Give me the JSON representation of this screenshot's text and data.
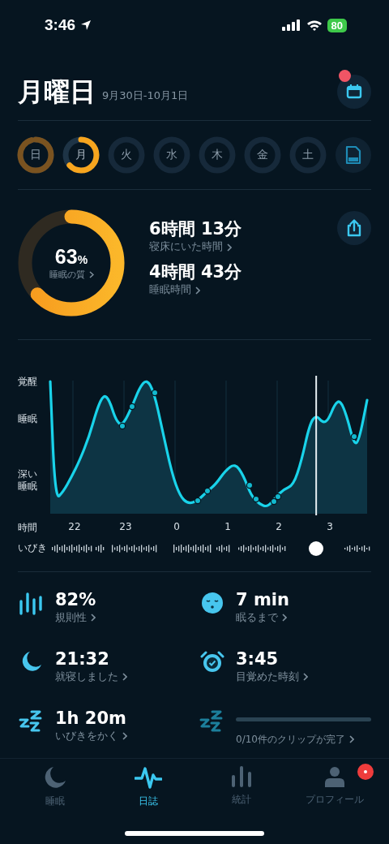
{
  "status_bar": {
    "time": "3:46",
    "battery": "80"
  },
  "header": {
    "title": "月曜日",
    "date_range": "9月30日-10月1日",
    "calendar_badge": true
  },
  "days": [
    {
      "label": "日",
      "has_data": true,
      "selected": false
    },
    {
      "label": "月",
      "has_data": true,
      "selected": true
    },
    {
      "label": "火",
      "has_data": false,
      "selected": false
    },
    {
      "label": "水",
      "has_data": false,
      "selected": false
    },
    {
      "label": "木",
      "has_data": false,
      "selected": false
    },
    {
      "label": "金",
      "has_data": false,
      "selected": false
    },
    {
      "label": "土",
      "has_data": false,
      "selected": false
    }
  ],
  "summary": {
    "quality": {
      "value": "63",
      "unit": "%",
      "label": "睡眠の質"
    },
    "metrics": [
      {
        "value": "6時間 13分",
        "label": "寝床にいた時間"
      },
      {
        "value": "4時間 43分",
        "label": "睡眠時間"
      }
    ]
  },
  "sleep_graph": {
    "y_labels": [
      "覚醒",
      "睡眠",
      "深い睡眠"
    ],
    "x_title": "時間",
    "x_labels": [
      "22",
      "23",
      "0",
      "1",
      "2",
      "3"
    ],
    "snore_title": "いびき"
  },
  "stats": [
    {
      "kind": "regularity",
      "value": "82%",
      "label": "規則性"
    },
    {
      "kind": "fall-asleep",
      "value": "7 min",
      "label": "眠るまで"
    },
    {
      "kind": "bedtime",
      "value": "21:32",
      "label": "就寝しました"
    },
    {
      "kind": "wake",
      "value": "3:45",
      "label": "目覚めた時刻"
    },
    {
      "kind": "snoring",
      "value": "1h 20m",
      "label": "いびきをかく"
    },
    {
      "kind": "clips",
      "label": "0/10件のクリップが完了"
    }
  ],
  "tabs": [
    {
      "kind": "sleep",
      "label": "睡眠",
      "selected": false,
      "badge": false
    },
    {
      "kind": "journal",
      "label": "日誌",
      "selected": true,
      "badge": false
    },
    {
      "kind": "stats",
      "label": "統計",
      "selected": false,
      "badge": false
    },
    {
      "kind": "profile",
      "label": "プロフィール",
      "selected": false,
      "badge": true
    }
  ]
}
